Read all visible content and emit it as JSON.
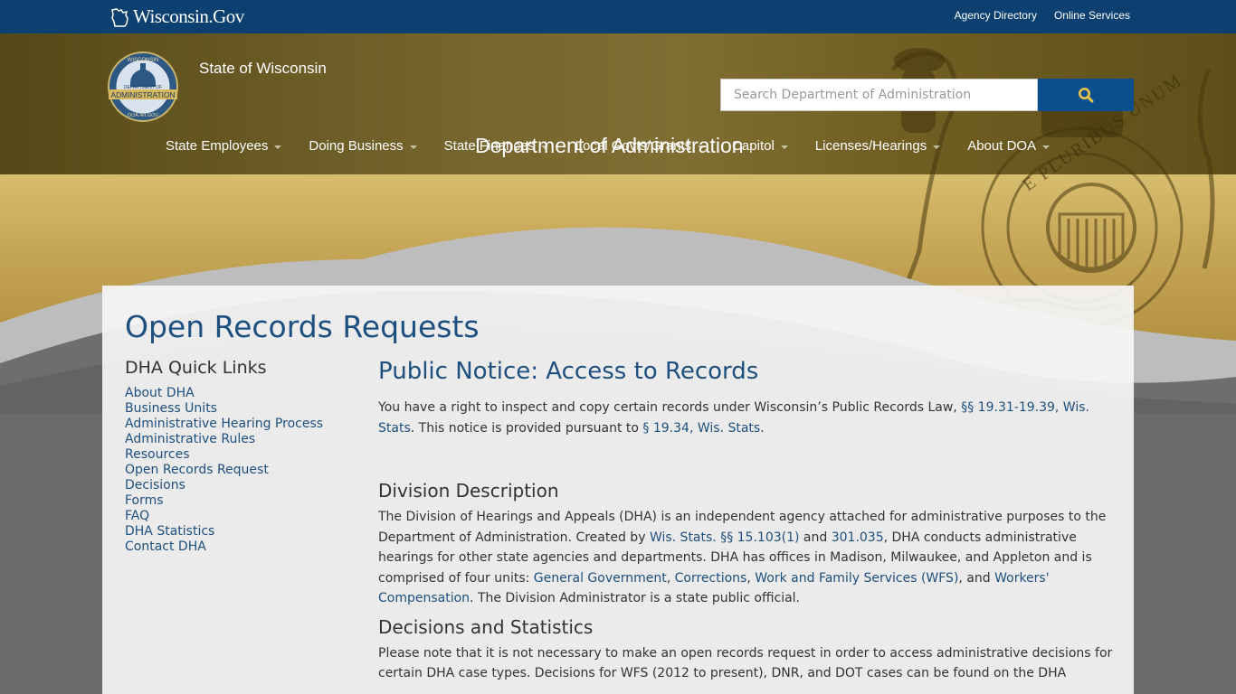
{
  "topbar": {
    "brand": "Wisconsin.Gov",
    "links": [
      "Agency Directory",
      "Online Services"
    ]
  },
  "header": {
    "seal_text": {
      "top": "WISCONSIN",
      "middle": "ADMINISTRATION",
      "bottom": "DOA.WI.GOV",
      "dept": "DEPARTMENT OF"
    },
    "state": "State of Wisconsin",
    "department": "Department of Administration",
    "search_placeholder": "Search Department of Administration",
    "nav": [
      "State Employees",
      "Doing Business",
      "State Finances",
      "Local Govts/Grants",
      "Capitol",
      "Licenses/Hearings",
      "About DOA"
    ],
    "seal_motto": "E PLURIBUS UNUM"
  },
  "page": {
    "title": "Open Records Requests"
  },
  "sidebar": {
    "heading": "DHA Quick Links",
    "links": [
      "About DHA",
      "Business Units",
      "Administrative Hearing Process",
      "Administrative Rules",
      "Resources",
      "Open Records Request",
      "Decisions",
      "Forms",
      "FAQ",
      "DHA Statistics",
      "Contact DHA"
    ]
  },
  "main": {
    "notice_title": "Public Notice:  Access to Records",
    "intro": {
      "t1": "You have a right to inspect and copy certain records under Wisconsin’s Public Records Law, ",
      "l1": "§§ 19.31-19.39, Wis. Stats",
      "t2": ". This notice is provided pursuant to ",
      "l2": "§ 19.34, Wis. Stats",
      "t3": "."
    },
    "division_heading": "Division Description",
    "division": {
      "t1": "The Division of Hearings and Appeals (DHA) is an independent agency attached for administrative purposes to the Department of Administration. Created by ",
      "l1": "Wis. Stats. §§ 15.103(1)",
      "t2": " and ",
      "l2": "301.035",
      "t3": ", DHA conducts administrative hearings for other state agencies and departments. DHA has offices in Madison, Milwaukee, and Appleton and is comprised of four units:  ",
      "l3": "General Government",
      "t4": ", ",
      "l4": "Corrections",
      "t5": ", ",
      "l5": "Work and Family Services (WFS)",
      "t6": ", and ",
      "l6": "Workers' Compensation",
      "t7": ". The Division Administrator is a state public official."
    },
    "decisions_heading": "Decisions and Statistics",
    "decisions_text": "Please note that it is not necessary to make an open records request in order to access administrative decisions for certain DHA case types. Decisions for WFS (2012 to present), DNR, and DOT cases can be found on the DHA"
  }
}
